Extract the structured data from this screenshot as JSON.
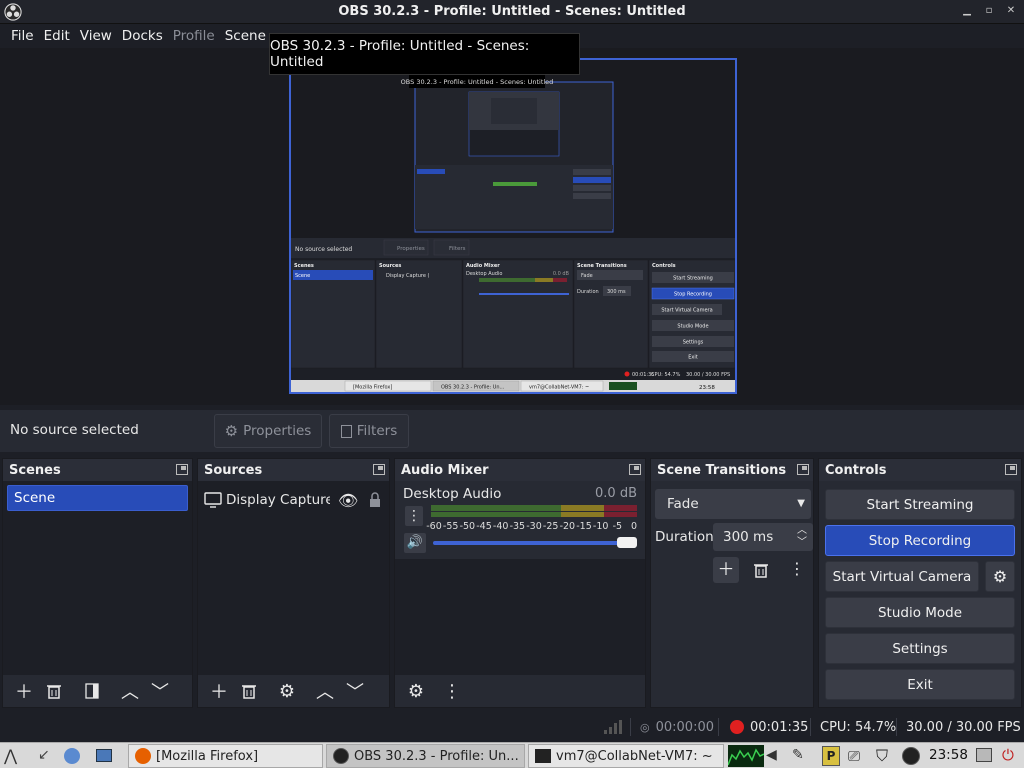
{
  "window": {
    "title": "OBS 30.2.3 - Profile: Untitled - Scenes: Untitled"
  },
  "menu": {
    "items": [
      "File",
      "Edit",
      "View",
      "Docks",
      "Profile",
      "Scene"
    ]
  },
  "tooltip": {
    "text": "OBS 30.2.3 - Profile: Untitled - Scenes: Untitled"
  },
  "preview": {
    "inner_title": "OBS 30.2.3 - Profile: Untitled - Scenes: Untitled",
    "no_source": "No source selected",
    "properties": "Properties",
    "filters": "Filters",
    "scenes": "Scenes",
    "scene": "Scene",
    "sources": "Sources",
    "display_capture": "Display Capture (",
    "audio_mixer": "Audio Mixer",
    "desktop_audio": "Desktop Audio",
    "db": "0.0 dB",
    "scene_transitions": "Scene Transitions",
    "fade": "Fade",
    "duration": "Duration",
    "duration_value": "300 ms",
    "controls": "Controls",
    "start_streaming": "Start Streaming",
    "stop_recording": "Stop Recording",
    "start_virtual_camera": "Start Virtual Camera",
    "studio_mode": "Studio Mode",
    "settings": "Settings",
    "exit": "Exit",
    "rec_time": "00:01:35",
    "cpu": "CPU: 54.7%",
    "fps": "30.00 / 30.00 FPS",
    "tasks": [
      "[Mozilla Firefox]",
      "OBS 30.2.3 - Profile: Un...",
      "vm7@CollabNet-VM7: ~"
    ],
    "clock": "23:58"
  },
  "source_toolbar": {
    "no_source": "No source selected",
    "properties": "Properties",
    "filters": "Filters"
  },
  "docks": {
    "scenes": {
      "title": "Scenes",
      "items": [
        "Scene"
      ]
    },
    "sources": {
      "title": "Sources",
      "items": [
        "Display Capture ("
      ]
    },
    "audio_mixer": {
      "title": "Audio Mixer",
      "channel": "Desktop Audio",
      "level": "0.0 dB",
      "scale": [
        "-60",
        "-55",
        "-50",
        "-45",
        "-40",
        "-35",
        "-30",
        "-25",
        "-20",
        "-15",
        "-10",
        "-5",
        "0"
      ],
      "volume": 1.0
    },
    "transitions": {
      "title": "Scene Transitions",
      "selected": "Fade",
      "duration_label": "Duration",
      "duration_value": "300 ms"
    },
    "controls": {
      "title": "Controls",
      "start_streaming": "Start Streaming",
      "stop_recording": "Stop Recording",
      "start_virtual_camera": "Start Virtual Camera",
      "studio_mode": "Studio Mode",
      "settings": "Settings",
      "exit": "Exit"
    }
  },
  "status": {
    "stream_time": "00:00:00",
    "rec_time": "00:01:35",
    "cpu": "CPU: 54.7%",
    "fps": "30.00 / 30.00 FPS"
  },
  "taskbar": {
    "tasks": [
      "[Mozilla Firefox]",
      "OBS 30.2.3 - Profile: Un...",
      "vm7@CollabNet-VM7: ~"
    ],
    "clock": "23:58"
  },
  "colors": {
    "accent": "#284cb8",
    "panel": "#272a33",
    "background": "#1d1f26",
    "record": "#e02020"
  }
}
